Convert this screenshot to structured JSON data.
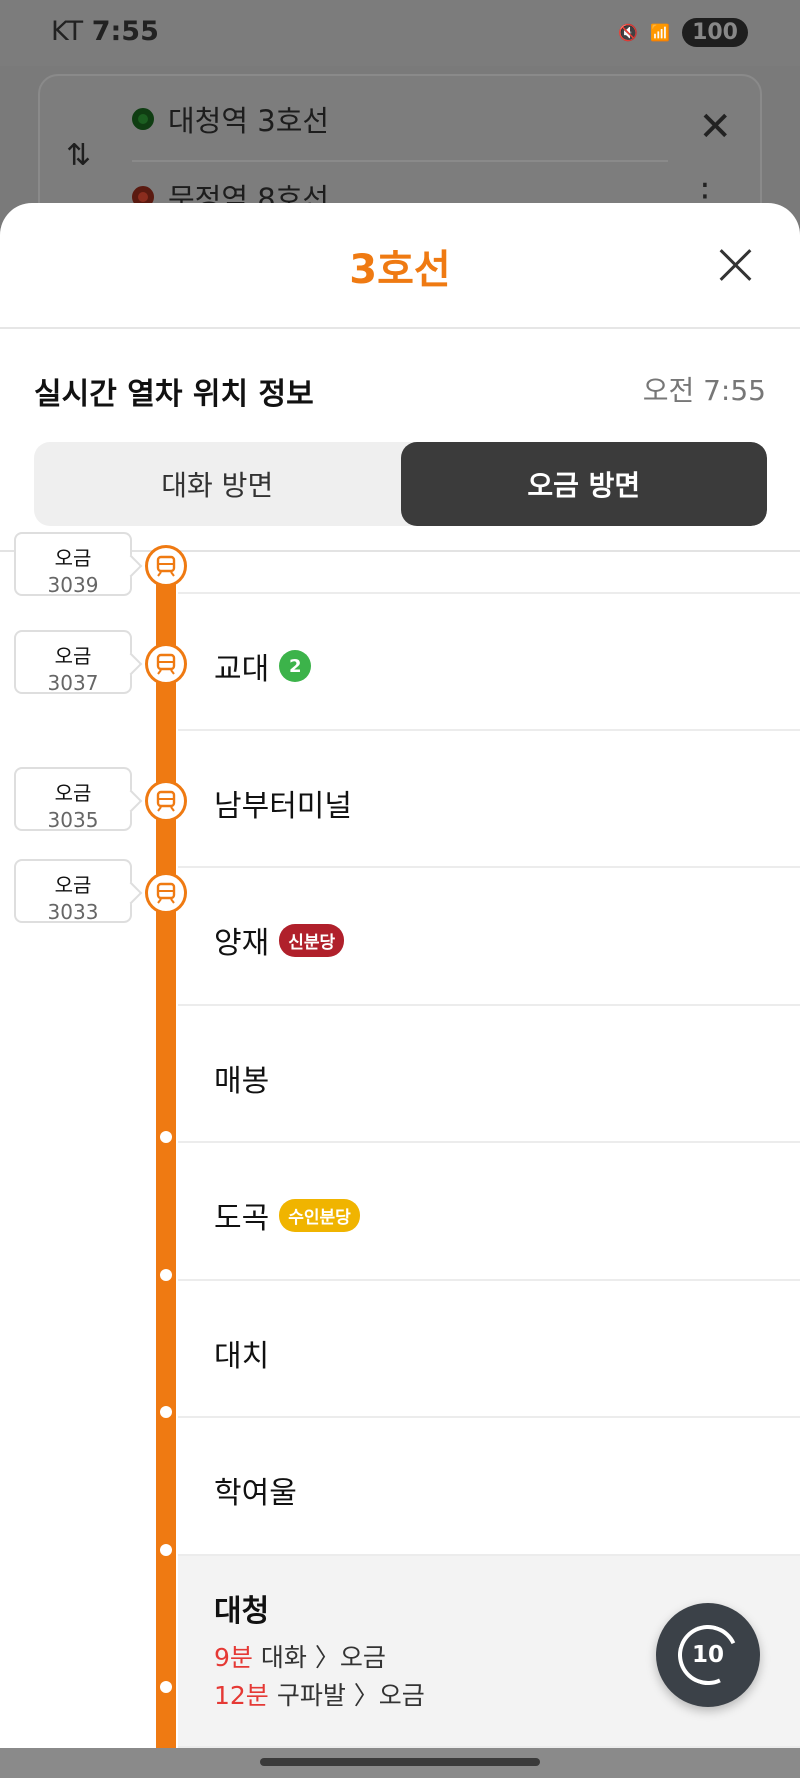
{
  "status_bar": {
    "carrier": "KT",
    "time": "7:55",
    "battery": "100"
  },
  "background": {
    "origin": "대청역 3호선",
    "destination": "문정역 8호선"
  },
  "sheet": {
    "title": "3호선",
    "info_title": "실시간 열차 위치 정보",
    "info_time": "오전 7:55",
    "tabs": [
      {
        "label": "대화 방면",
        "active": false
      },
      {
        "label": "오금 방면",
        "active": true
      }
    ]
  },
  "trains": [
    {
      "direction": "오금",
      "number": "3039"
    },
    {
      "direction": "오금",
      "number": "3037"
    },
    {
      "direction": "오금",
      "number": "3035"
    },
    {
      "direction": "오금",
      "number": "3033"
    }
  ],
  "stations": [
    {
      "name": "교대",
      "badge": "2",
      "badge_color": "#3cb34a"
    },
    {
      "name": "남부터미널"
    },
    {
      "name": "양재",
      "badge": "신분당",
      "badge_color": "#b0202b"
    },
    {
      "name": "매봉"
    },
    {
      "name": "도곡",
      "badge": "수인분당",
      "badge_color": "#f0b400"
    },
    {
      "name": "대치"
    },
    {
      "name": "학여울"
    },
    {
      "name": "대청",
      "arrivals": [
        {
          "min": "9분",
          "route": "대화 〉오금"
        },
        {
          "min": "12분",
          "route": "구파발 〉오금"
        }
      ]
    }
  ],
  "refresh": {
    "label": "10"
  },
  "colors": {
    "line3": "#ef7a12"
  }
}
